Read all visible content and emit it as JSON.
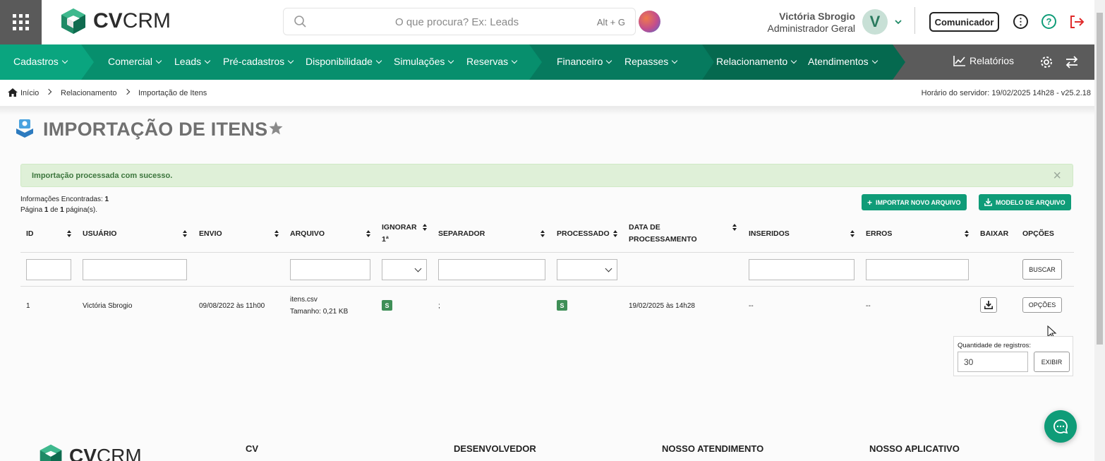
{
  "header": {
    "app_name_bold": "CV",
    "app_name_rest": "CRM",
    "search_placeholder": "O que procura? Ex: Leads",
    "search_shortcut": "Alt + G",
    "user_name": "Victória Sbrogio",
    "user_role": "Administrador Geral",
    "avatar_letter": "V",
    "communicator_label": "Comunicador"
  },
  "nav": {
    "items": [
      "Cadastros",
      "Comercial",
      "Leads",
      "Pré-cadastros",
      "Disponibilidade",
      "Simulações",
      "Reservas",
      "Financeiro",
      "Repasses",
      "Relacionamento",
      "Atendimentos"
    ],
    "reports_label": "Relatórios",
    "colors": {
      "cadastros": "#0aa57f",
      "comercial": "#078f6d",
      "financeiro": "#067a5e",
      "relacionamento": "#05694f",
      "rest": "#5b5b5b"
    }
  },
  "breadcrumb": {
    "items": [
      "Início",
      "Relacionamento",
      "Importação de Itens"
    ],
    "server_time": "Horário do servidor: 19/02/2025 14h28 - v25.2.18"
  },
  "page": {
    "title": "IMPORTAÇÃO DE ITENS",
    "alert": "Importação processada com sucesso.",
    "info_found_label": "Informações Encontradas:",
    "info_found_count": "1",
    "page_word": "Página",
    "page_current": "1",
    "page_of": "de",
    "page_total": "1",
    "page_suffix": "página(s).",
    "import_button": "IMPORTAR NOVO ARQUIVO",
    "template_button": "MODELO DE ARQUIVO"
  },
  "table": {
    "headers": {
      "id": "ID",
      "usuario": "USUÁRIO",
      "envio": "ENVIO",
      "arquivo": "ARQUIVO",
      "ignorar_1": "IGNORAR",
      "ignorar_2": "1ª",
      "separador": "SEPARADOR",
      "processado": "PROCESSADO",
      "data_1": "DATA DE",
      "data_2": "PROCESSAMENTO",
      "inseridos": "INSERIDOS",
      "erros": "ERROS",
      "baixar": "BAIXAR",
      "opcoes": "OPÇÕES"
    },
    "search_button": "BUSCAR",
    "rows": [
      {
        "id": "1",
        "usuario": "Victória Sbrogio",
        "envio": "09/08/2022 às 11h00",
        "arquivo_nome": "itens.csv",
        "arquivo_tamanho": "Tamanho: 0,21 KB",
        "ignorar": "S",
        "separador": ";",
        "processado": "S",
        "data_processamento": "19/02/2025 às 14h28",
        "inseridos": "--",
        "erros": "--",
        "opcoes": "OPÇÕES"
      }
    ]
  },
  "records": {
    "label": "Quantidade de registros:",
    "value": "30",
    "button": "EXIBIR"
  },
  "footer": {
    "col1": "CV",
    "col2": "DESENVOLVEDOR",
    "col3": "NOSSO ATENDIMENTO",
    "col4": "NOSSO APLICATIVO"
  }
}
